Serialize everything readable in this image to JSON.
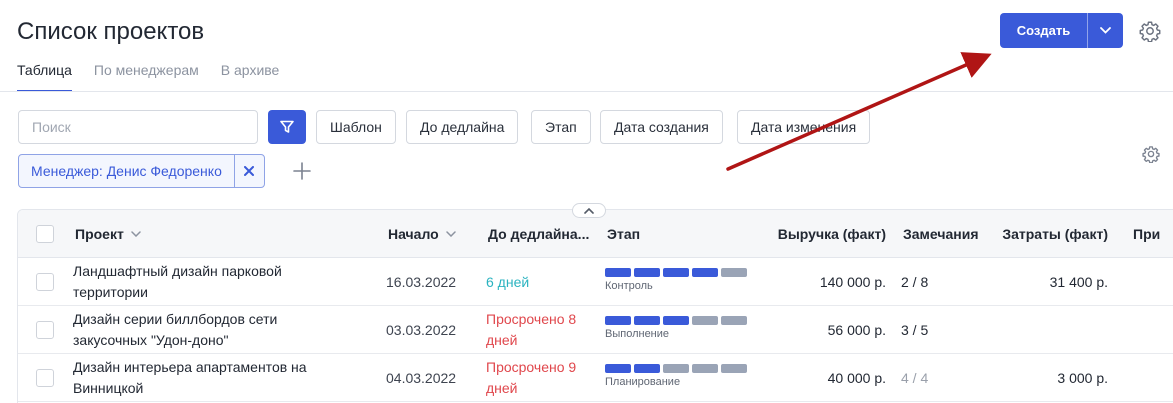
{
  "page": {
    "title": "Список проектов"
  },
  "tabs": [
    {
      "label": "Таблица",
      "active": true
    },
    {
      "label": "По менеджерам",
      "active": false
    },
    {
      "label": "В архиве",
      "active": false
    }
  ],
  "toolbar": {
    "create_label": "Создать"
  },
  "filters": {
    "search_placeholder": "Поиск",
    "chips": [
      "Шаблон",
      "До дедлайна",
      "Этап",
      "Дата создания",
      "Дата изменения"
    ],
    "manager_chip": "Менеджер: Денис Федоренко"
  },
  "table": {
    "columns": {
      "project": "Проект",
      "start": "Начало",
      "deadline": "До дедлайна...",
      "stage": "Этап",
      "revenue": "Выручка (факт)",
      "remarks": "Замечания",
      "costs": "Затраты (факт)",
      "extra": "При"
    },
    "rows": [
      {
        "name": "Ландшафтный дизайн парковой территории",
        "start": "16.03.2022",
        "deadline": "6 дней",
        "deadline_status": "ok",
        "stage_label": "Контроль",
        "stage_progress": 4,
        "stage_total": 5,
        "revenue": "140 000 р.",
        "remarks": "2 / 8",
        "costs": "31 400 р."
      },
      {
        "name": "Дизайн серии биллбордов сети закусочных \"Удон-доно\"",
        "start": "03.03.2022",
        "deadline": "Просрочено 8 дней",
        "deadline_status": "late",
        "stage_label": "Выполнение",
        "stage_progress": 3,
        "stage_total": 5,
        "revenue": "56 000 р.",
        "remarks": "3 / 5",
        "costs": ""
      },
      {
        "name": "Дизайн интерьера апартаментов на Винницкой",
        "start": "04.03.2022",
        "deadline": "Просрочено 9 дней",
        "deadline_status": "late",
        "stage_label": "Планирование",
        "stage_progress": 2,
        "stage_total": 5,
        "revenue": "40 000 р.",
        "remarks": "4 / 4",
        "costs": "3 000 р."
      }
    ]
  },
  "colors": {
    "accent": "#3a5ad9",
    "deadline_ok": "#2bb3c0",
    "deadline_late": "#e0474c",
    "annotation_arrow": "#b01515"
  }
}
